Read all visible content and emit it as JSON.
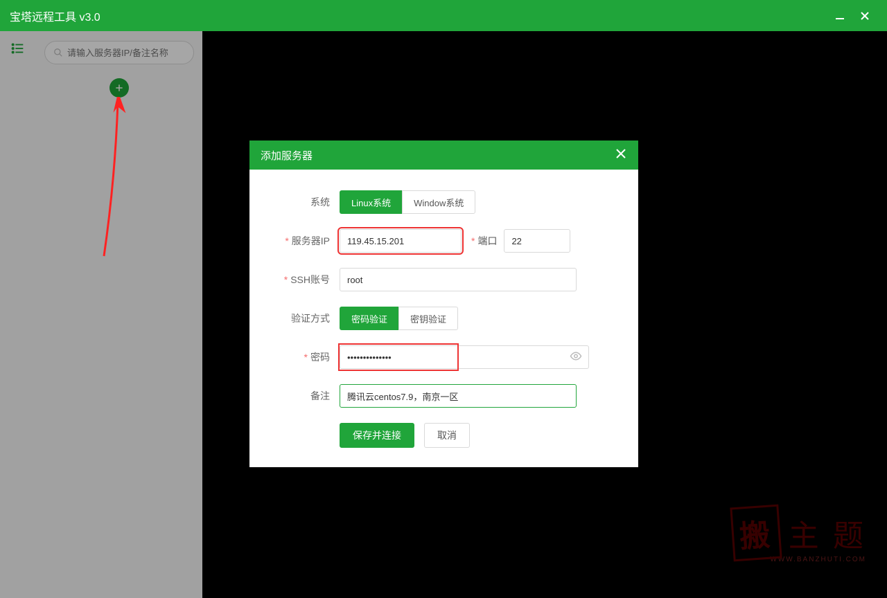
{
  "titleBar": {
    "title": "宝塔远程工具 v3.0"
  },
  "sidebar": {
    "searchPlaceholder": "请输入服务器IP/备注名称"
  },
  "modal": {
    "title": "添加服务器",
    "labels": {
      "system": "系统",
      "serverIp": "服务器IP",
      "port": "端口",
      "sshAccount": "SSH账号",
      "authMethod": "验证方式",
      "password": "密码",
      "remark": "备注"
    },
    "systemTabs": {
      "linux": "Linux系统",
      "windows": "Window系统"
    },
    "authTabs": {
      "password": "密码验证",
      "key": "密钥验证"
    },
    "values": {
      "ip": "119.45.15.201",
      "port": "22",
      "ssh": "root",
      "password": "••••••••••••••",
      "remark": "腾讯云centos7.9，南京一区"
    },
    "buttons": {
      "save": "保存并连接",
      "cancel": "取消"
    }
  },
  "watermark": {
    "stamp": "搬",
    "text": "主 题",
    "sub": "WWW.BANZHUTI.COM"
  }
}
